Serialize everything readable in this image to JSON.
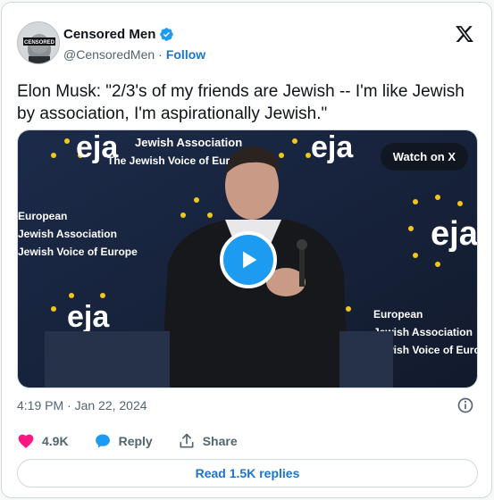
{
  "author": {
    "name": "Censored Men",
    "handle": "@CensoredMen",
    "separator": "·",
    "follow_label": "Follow",
    "avatar_text": "CENSORED"
  },
  "tweet": {
    "text": "Elon Musk: \"2/3's of my friends are Jewish -- I'm like Jewish by association, I'm aspirationally Jewish.\"",
    "timestamp": "4:19 PM · Jan 22, 2024"
  },
  "media": {
    "watch_label": "Watch on X",
    "backdrop": {
      "logo": "eja",
      "org_name": "Jewish Association",
      "tagline": "The Jewish Voice of Europe",
      "org_lines": [
        "European",
        "Jewish Association",
        "Jewish Voice of Europe"
      ]
    }
  },
  "actions": {
    "likes": "4.9K",
    "reply_label": "Reply",
    "share_label": "Share",
    "read_replies_label": "Read 1.5K replies"
  },
  "colors": {
    "accent": "#1d9bf0",
    "link": "#1d74c9",
    "like": "#f91880",
    "backdrop": "#1a2640"
  }
}
